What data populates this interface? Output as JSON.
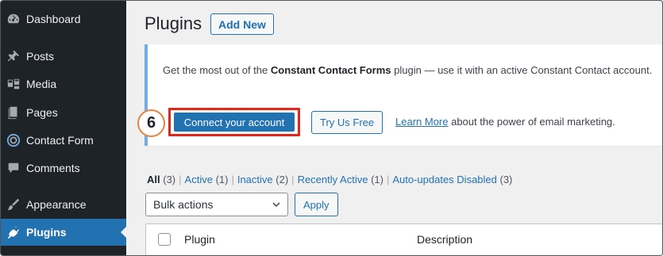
{
  "sidebar": {
    "items": [
      {
        "label": "Dashboard",
        "icon": "dashboard-icon"
      },
      {
        "label": "Posts",
        "icon": "pushpin-icon"
      },
      {
        "label": "Media",
        "icon": "media-icon"
      },
      {
        "label": "Pages",
        "icon": "pages-icon"
      },
      {
        "label": "Contact Form",
        "icon": "contact-form-icon"
      },
      {
        "label": "Comments",
        "icon": "comment-icon"
      },
      {
        "label": "Appearance",
        "icon": "paintbrush-icon"
      },
      {
        "label": "Plugins",
        "icon": "plugin-icon",
        "active": true
      }
    ]
  },
  "header": {
    "title": "Plugins",
    "add_new": "Add New"
  },
  "notice": {
    "text_before": "Get the most out of the ",
    "plugin_name": "Constant Contact Forms",
    "text_after": " plugin — use it with an active Constant Contact account.",
    "step_number": "6",
    "connect_label": "Connect your account",
    "try_label": "Try Us Free",
    "learn_more": "Learn More",
    "learn_suffix": " about the power of email marketing."
  },
  "filters": [
    {
      "label": "All",
      "count": "(3)",
      "current": true
    },
    {
      "label": "Active",
      "count": "(1)"
    },
    {
      "label": "Inactive",
      "count": "(2)"
    },
    {
      "label": "Recently Active",
      "count": "(1)"
    },
    {
      "label": "Auto-updates Disabled",
      "count": "(3)"
    }
  ],
  "bulk": {
    "selected": "Bulk actions",
    "apply": "Apply"
  },
  "table": {
    "columns": [
      "Plugin",
      "Description"
    ]
  },
  "colors": {
    "accent": "#2271b1",
    "sidebar_bg": "#1d2327",
    "highlight_box": "#e3261b",
    "step_badge_border": "#e8833a"
  }
}
